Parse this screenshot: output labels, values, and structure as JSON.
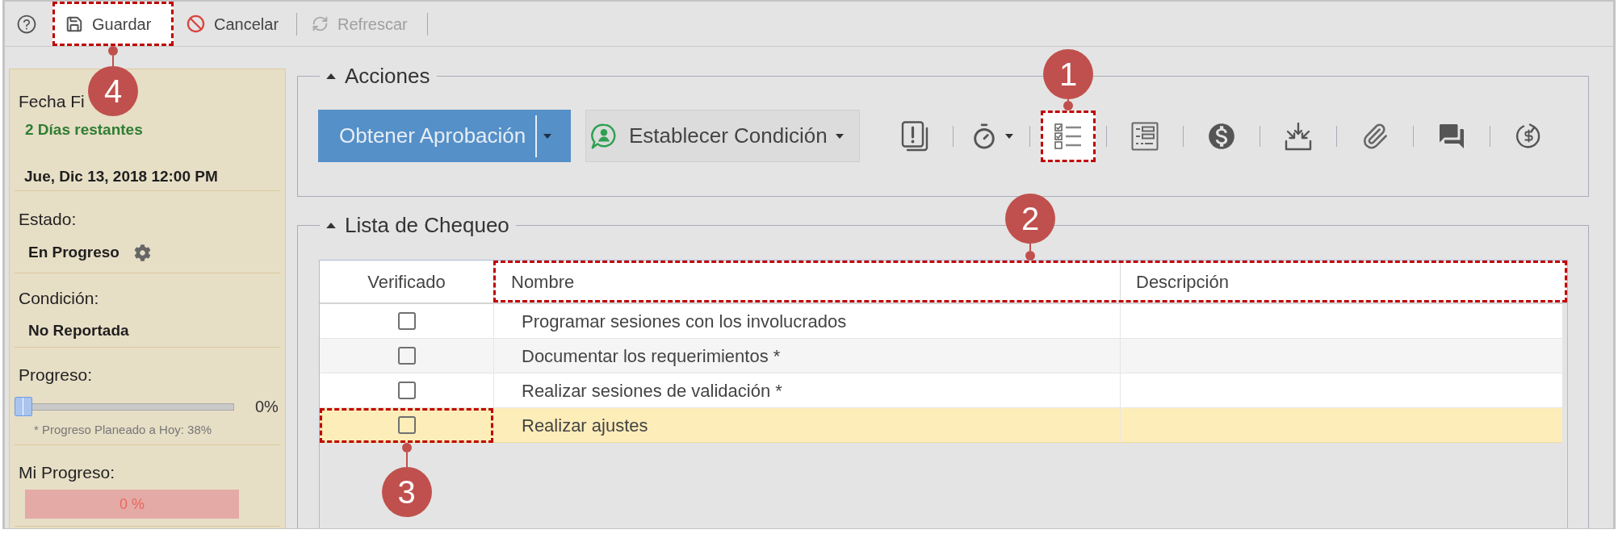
{
  "toolbar": {
    "buttons": [
      {
        "label": "Guardar",
        "disabled": false,
        "callout": "4"
      },
      {
        "label": "Cancelar",
        "disabled": false
      },
      {
        "label": "Refrescar",
        "disabled": true
      }
    ]
  },
  "sidebar": {
    "due": {
      "label": "Fecha Fi",
      "remaining": "2 Días restantes",
      "date": "Jue, Dic 13, 2018 12:00 PM"
    },
    "status": {
      "label": "Estado:",
      "value": "En Progreso"
    },
    "condition": {
      "label": "Condición:",
      "value": "No Reportada"
    },
    "progress": {
      "label": "Progreso:",
      "level": 0,
      "reading": "0%",
      "note": "* Progreso Planeado a Hoy: 38%"
    },
    "my_progress": {
      "label": "Mi Progreso:",
      "reading": "0 %"
    }
  },
  "actions": {
    "title": "Acciones",
    "expanded": true,
    "approval_button": "Obtener Aprobación",
    "condition_button": "Establecer Condición",
    "tools": [
      {
        "menu": false
      },
      {
        "menu": true
      },
      {
        "menu": false,
        "callout": "1"
      },
      {
        "menu": false
      },
      {
        "menu": false
      },
      {
        "menu": false
      },
      {
        "menu": false
      },
      {
        "menu": false
      },
      {
        "menu": false
      }
    ]
  },
  "checklist": {
    "title": "Lista de Chequeo",
    "expanded": true,
    "columns": [
      "Verificado",
      "Nombre",
      "Descripción"
    ],
    "header_callout": "2",
    "rows": [
      {
        "checked": false,
        "name": "Programar sesiones con los involucrados",
        "selected": false
      },
      {
        "checked": false,
        "name": "Documentar los requerimientos *",
        "selected": false
      },
      {
        "checked": false,
        "name": "Realizar sesiones de validación *",
        "selected": false
      },
      {
        "checked": false,
        "name": "Realizar ajustes",
        "selected": true,
        "callout": "3"
      }
    ]
  }
}
